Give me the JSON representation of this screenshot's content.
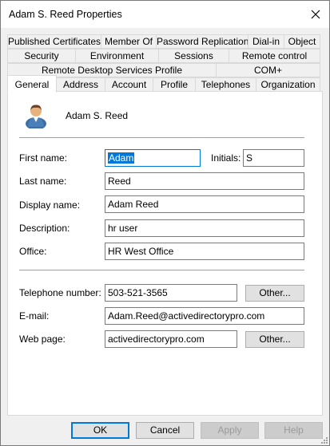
{
  "window": {
    "title": "Adam S. Reed Properties",
    "close_icon": "close-icon"
  },
  "tabs": {
    "row1": [
      "Published Certificates",
      "Member Of",
      "Password Replication",
      "Dial-in",
      "Object"
    ],
    "row2": [
      "Security",
      "Environment",
      "Sessions",
      "Remote control"
    ],
    "row3": [
      "Remote Desktop Services Profile",
      "COM+"
    ],
    "row4": [
      "General",
      "Address",
      "Account",
      "Profile",
      "Telephones",
      "Organization"
    ],
    "active": "General"
  },
  "general": {
    "user_icon": "user-icon",
    "display_heading": "Adam S. Reed",
    "first_name": {
      "label": "First name:",
      "value": "Adam"
    },
    "initials": {
      "label": "Initials:",
      "value": "S"
    },
    "last_name": {
      "label": "Last name:",
      "value": "Reed"
    },
    "display_name": {
      "label": "Display name:",
      "value": "Adam Reed"
    },
    "description": {
      "label": "Description:",
      "value": "hr user"
    },
    "office": {
      "label": "Office:",
      "value": "HR West Office"
    },
    "telephone": {
      "label": "Telephone number:",
      "value": "503-521-3565",
      "other_label": "Other..."
    },
    "email": {
      "label": "E-mail:",
      "value": "Adam.Reed@activedirectorypro.com"
    },
    "web_page": {
      "label": "Web page:",
      "value": "activedirectorypro.com",
      "other_label": "Other..."
    }
  },
  "buttons": {
    "ok": "OK",
    "cancel": "Cancel",
    "apply": "Apply",
    "help": "Help"
  },
  "colors": {
    "accent": "#0078d7",
    "dialog_bg": "#f0f0f0",
    "panel_bg": "#ffffff"
  }
}
